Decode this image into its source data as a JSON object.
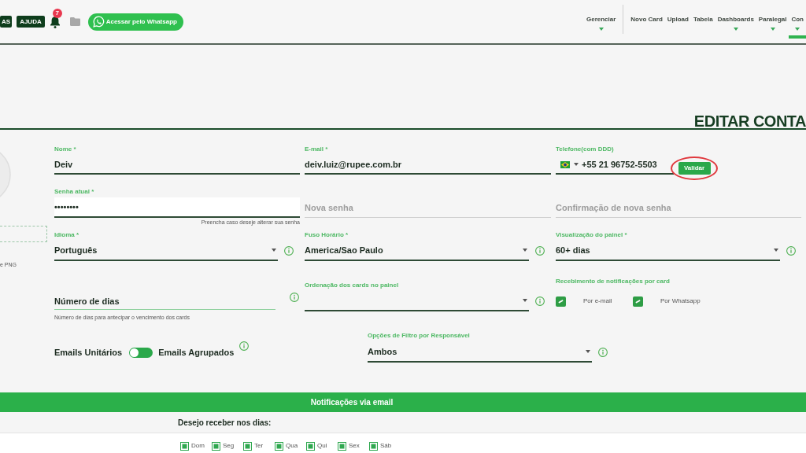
{
  "top_bar": {
    "buttons": [
      {
        "label": "AS"
      },
      {
        "label": "AJUDA"
      }
    ],
    "notification_count": "7",
    "whatsapp_button": {
      "label": "Acessar pelo Whatsapp"
    },
    "nav_groups": [
      {
        "items": [
          {
            "label": "Gerenciar",
            "dropdown": true,
            "selected": false
          }
        ]
      },
      {
        "items": [
          {
            "label": "Novo Card",
            "dropdown": false,
            "selected": false
          },
          {
            "label": "Upload",
            "dropdown": false,
            "selected": false
          },
          {
            "label": "Tabela",
            "dropdown": false,
            "selected": false
          },
          {
            "label": "Dashboards",
            "dropdown": true,
            "selected": false
          },
          {
            "label": "Paralegal",
            "dropdown": true,
            "selected": false
          },
          {
            "label": "Con",
            "dropdown": true,
            "selected": true
          }
        ]
      }
    ]
  },
  "page_title": "EDITAR CONTA",
  "profile": {
    "photo_formats_hint": "e PNG"
  },
  "form": {
    "name": {
      "label": "Nome *",
      "value": "Deiv"
    },
    "email": {
      "label": "E-mail *",
      "value": "deiv.luiz@rupee.com.br"
    },
    "phone": {
      "label": "Telefone(com DDD)",
      "value": "+55 21 96752-5503",
      "validate_button": {
        "label": "Validar",
        "highlighted": true
      }
    },
    "current_password": {
      "label": "Senha atual *",
      "value": "••••••••",
      "hint": "Preencha caso deseje alterar sua senha"
    },
    "new_password": {
      "placeholder": "Nova senha"
    },
    "confirm_password": {
      "placeholder": "Confirmação de nova senha"
    },
    "language": {
      "label": "Idioma *",
      "value": "Português"
    },
    "timezone": {
      "label": "Fuso Horário *",
      "value": "America/Sao Paulo"
    },
    "panel_view": {
      "label": "Visualização do painel *",
      "value": "60+ dias"
    },
    "days_number": {
      "placeholder": "Número de dias",
      "hint": "Número de dias para antecipar o vencimento dos cards"
    },
    "card_order": {
      "label": "Ordenação dos cards no painel"
    },
    "card_notifications": {
      "label": "Recebimento de notificações por card",
      "options": [
        {
          "label": "Por e-mail",
          "checked": true
        },
        {
          "label": "Por Whatsapp",
          "checked": true
        }
      ]
    },
    "email_grouping": {
      "left_label": "Emails Unitários",
      "right_label": "Emails Agrupados",
      "grouped": false
    },
    "responsible_filter": {
      "label": "Opções de Filtro por Responsável",
      "value": "Ambos"
    }
  },
  "email_notifications": {
    "title": "Notificações via email",
    "days_label": "Desejo receber nos dias:",
    "days": [
      {
        "label": "Dom",
        "checked": true
      },
      {
        "label": "Seg",
        "checked": true
      },
      {
        "label": "Ter",
        "checked": true
      },
      {
        "label": "Qua",
        "checked": true
      },
      {
        "label": "Qui",
        "checked": true
      },
      {
        "label": "Sex",
        "checked": true
      },
      {
        "label": "Sáb",
        "checked": true
      }
    ]
  }
}
